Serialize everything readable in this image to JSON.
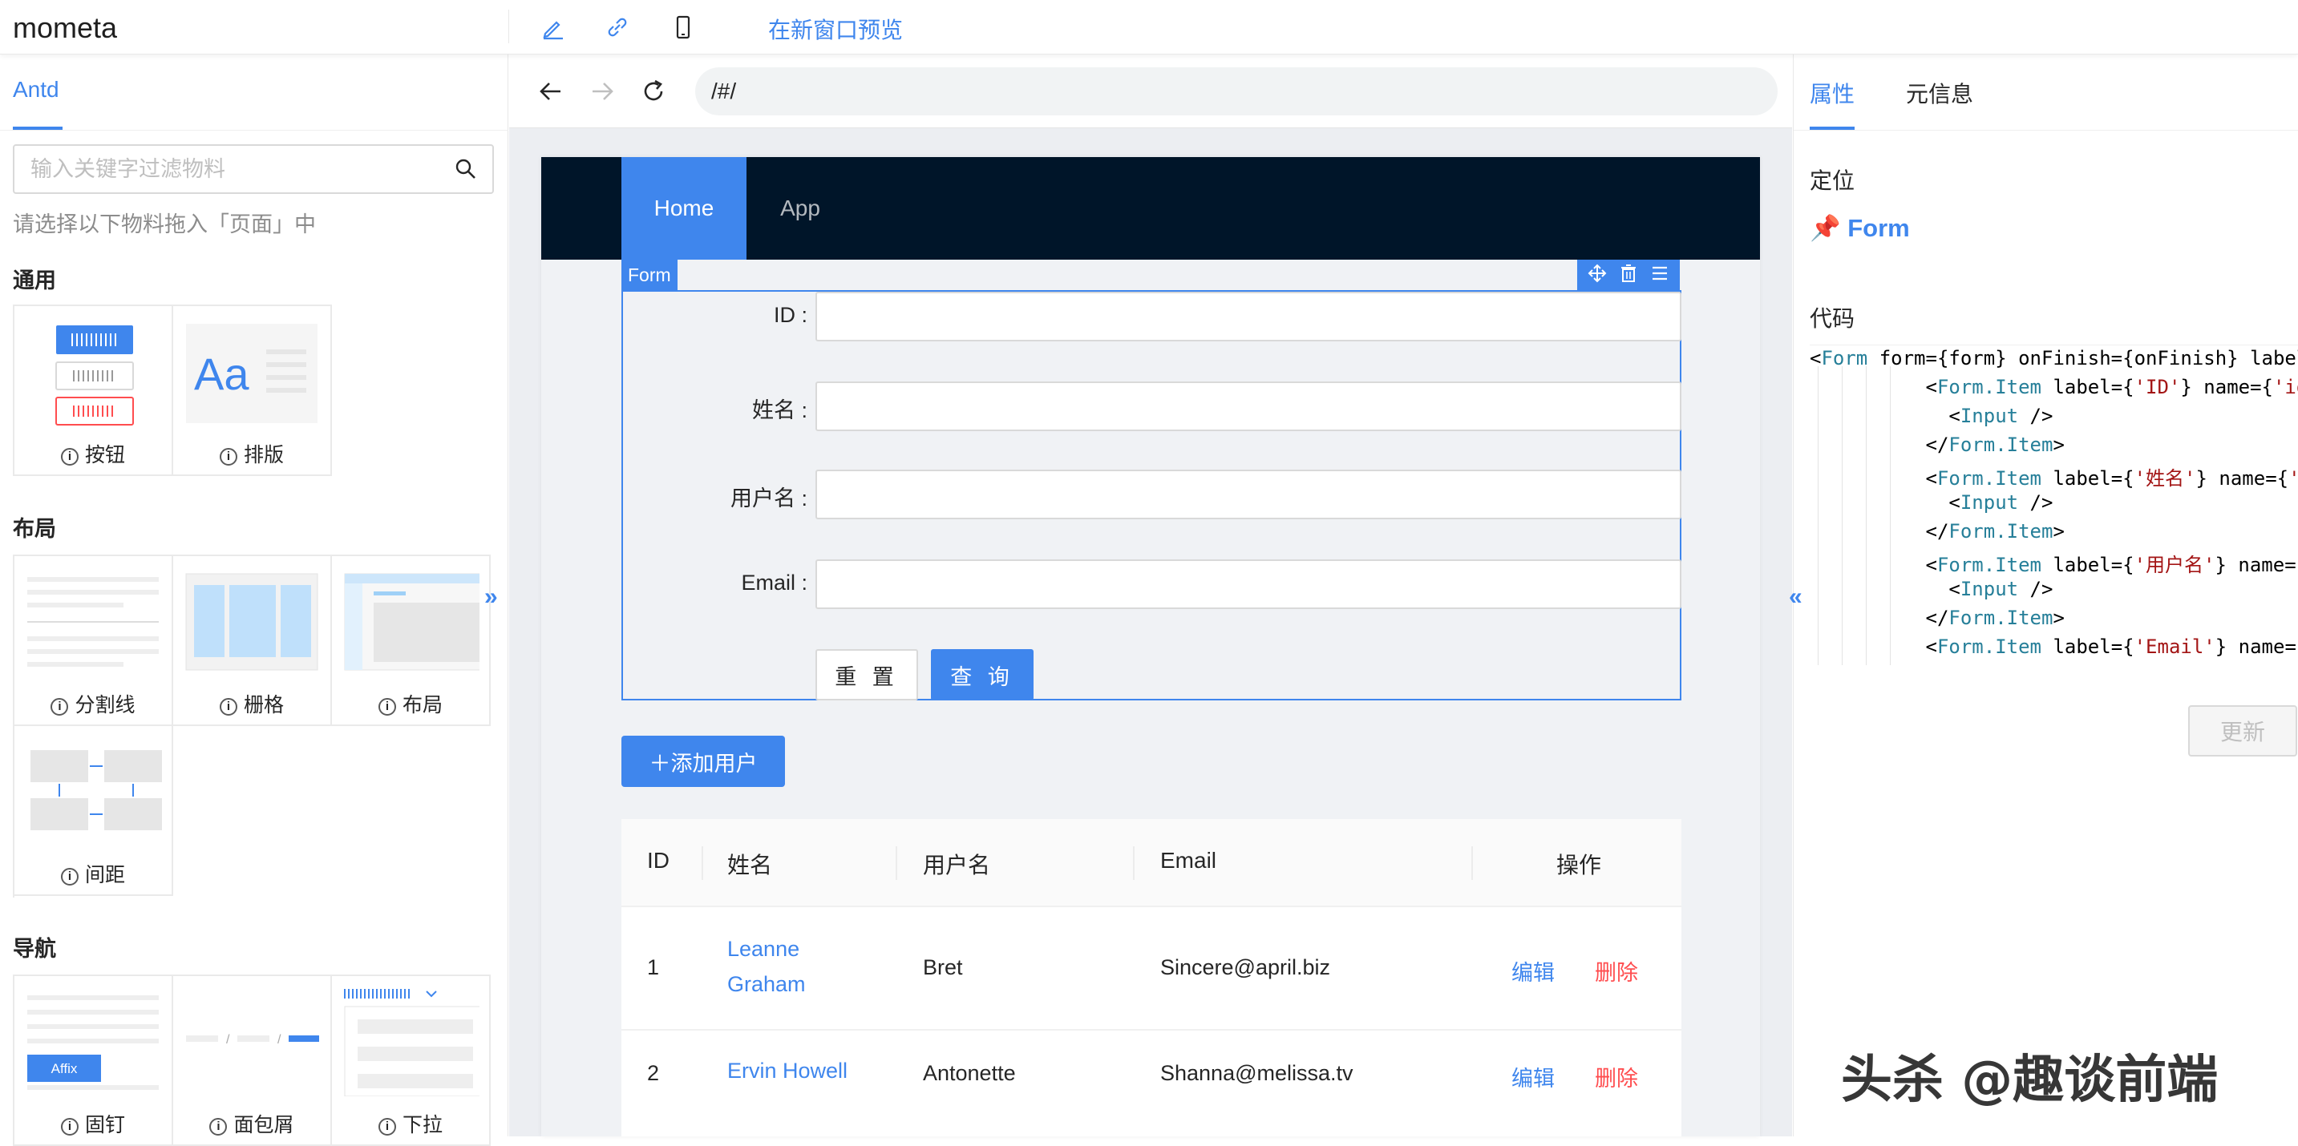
{
  "app": {
    "logo": "mometa",
    "preview_label": "在新窗口预览"
  },
  "left": {
    "tab": "Antd",
    "filter_placeholder": "输入关键字过滤物料",
    "hint": "请选择以下物料拖入「页面」中",
    "sections": {
      "general": {
        "title": "通用",
        "items": [
          "按钮",
          "排版"
        ]
      },
      "layout": {
        "title": "布局",
        "items": [
          "分割线",
          "栅格",
          "布局",
          "间距"
        ]
      },
      "nav": {
        "title": "导航",
        "items": [
          "固钉",
          "面包屑",
          "下拉"
        ]
      }
    },
    "thumb_text": {
      "typography": "Aa",
      "affix": "Affix"
    }
  },
  "browser": {
    "url": "/#/"
  },
  "canvas": {
    "menu": {
      "home": "Home",
      "app": "App"
    },
    "form_tag": "Form",
    "form": {
      "labels": [
        "ID",
        "姓名",
        "用户名",
        "Email"
      ],
      "reset": "重 置",
      "query": "查 询"
    },
    "add_button": "＋添加用户",
    "table": {
      "headers": [
        "ID",
        "姓名",
        "用户名",
        "Email",
        "操作"
      ],
      "rows": [
        {
          "id": "1",
          "name_line1": "Leanne",
          "name_line2": "Graham",
          "username": "Bret",
          "email": "Sincere@april.biz",
          "edit": "编辑",
          "delete": "删除"
        },
        {
          "id": "2",
          "name_line1": "Ervin Howell",
          "name_line2": "",
          "username": "Antonette",
          "email": "Shanna@melissa.tv",
          "edit": "编辑",
          "delete": "删除"
        }
      ]
    }
  },
  "right": {
    "tabs": [
      "属性",
      "元信息"
    ],
    "position_label": "定位",
    "position_value": "📌 Form",
    "code_label": "代码",
    "update_button": "更新"
  },
  "watermark": "头杀 @趣谈前端",
  "colors": {
    "primary": "#3f86ed",
    "header_dark": "#001529",
    "danger": "#ff4d4f"
  }
}
